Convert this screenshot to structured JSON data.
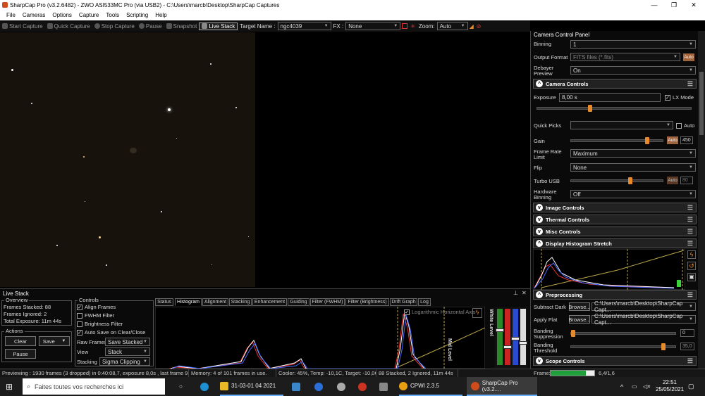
{
  "window": {
    "title": "SharpCap Pro (v3.2.6482) - ZWO ASI533MC Pro (via USB2) - C:\\Users\\marcb\\Desktop\\SharpCap Captures",
    "minimize_glyph": "—",
    "maximize_glyph": "❐",
    "close_glyph": "✕"
  },
  "menu": [
    "File",
    "Cameras",
    "Options",
    "Capture",
    "Tools",
    "Scripting",
    "Help"
  ],
  "toolbar": {
    "start_capture": "Start Capture",
    "quick_capture": "Quick Capture",
    "stop_capture": "Stop Capture",
    "pause": "Pause",
    "snapshot": "Snapshot",
    "live_stack": "Live Stack",
    "target_label": "Target Name :",
    "target_value": "ngc4039",
    "fx_label": "FX :",
    "fx_value": "None",
    "zoom_label": "Zoom:",
    "zoom_value": "Auto"
  },
  "camera_panel": {
    "title": "Camera Control Panel",
    "binning_label": "Binning",
    "binning_value": "1",
    "output_format_label": "Output Format",
    "output_format_value": "FITS files (*.fits)",
    "output_auto": "Auto",
    "debayer_label": "Debayer Preview",
    "debayer_value": "On",
    "sections": {
      "camera_controls": "Camera Controls",
      "image_controls": "Image Controls",
      "thermal_controls": "Thermal Controls",
      "misc_controls": "Misc Controls",
      "display_histogram": "Display Histogram Stretch",
      "preprocessing": "Preprocessing",
      "scope_controls": "Scope Controls"
    },
    "exposure_label": "Exposure",
    "exposure_value": "8,00 s",
    "lx_mode_label": "LX Mode",
    "quick_picks_label": "Quick Picks",
    "quick_picks_auto": "Auto",
    "gain_label": "Gain",
    "gain_auto": "Auto",
    "gain_value": "450",
    "gain_level": 0.85,
    "frame_rate_label": "Frame Rate Limit",
    "frame_rate_value": "Maximum",
    "flip_label": "Flip",
    "flip_value": "None",
    "turbo_label": "Turbo USB",
    "turbo_auto": "Auto",
    "turbo_value": "80",
    "turbo_level": 0.65,
    "hw_binning_label": "Hardware Binning",
    "hw_binning_value": "Off",
    "subtract_dark_label": "Subtract Dark",
    "subtract_dark_browse": "Browse...",
    "subtract_dark_path": "C:\\Users\\marcb\\Desktop\\SharpCap Capt...",
    "apply_flat_label": "Apply Flat",
    "apply_flat_browse": "Browse...",
    "apply_flat_path": "C:\\Users\\marcb\\Desktop\\SharpCap Capt...",
    "banding_suppression_label": "Banding Suppression",
    "banding_suppression_value": "0",
    "banding_threshold_label": "Banding Threshold",
    "banding_threshold_value": "35,0",
    "frame_label": "Frame:",
    "frame_value": "6,4/1,6",
    "frame_level": 0.8
  },
  "live_stack": {
    "title": "Live Stack",
    "pin_glyph": "⊥",
    "close_glyph": "✕",
    "overview_title": "Overview",
    "frames_stacked_label": "Frames Stacked:",
    "frames_stacked": "88",
    "frames_ignored_label": "Frames Ignored:",
    "frames_ignored": "2",
    "total_exposure_label": "Total Exposure:",
    "total_exposure": "11m 44s",
    "actions_title": "Actions",
    "clear": "Clear",
    "save": "Save",
    "pause": "Pause",
    "controls_title": "Controls",
    "align_frames": "Align Frames",
    "fwhm_filter": "FWHM Filter",
    "brightness_filter": "Brightness Filter",
    "auto_save": "Auto Save on Clear/Close",
    "raw_frames_label": "Raw Frames",
    "raw_frames_value": "Save Stacked",
    "view_label": "View",
    "view_value": "Stack",
    "stacking_label": "Stacking",
    "stacking_value": "Sigma Clipping",
    "tabs": [
      "Status",
      "Histogram",
      "Alignment",
      "Stacking",
      "Enhancement",
      "Guiding",
      "Filter (FWHM)",
      "Filter (Brightness)",
      "Drift Graph",
      "Log"
    ],
    "log_axis_label": "Logarithmic Horizontal Axis",
    "mid_level_label": "Mid Level",
    "white_level_label": "White Level"
  },
  "status_bar": {
    "preview": "Previewing : 1930 frames (3 dropped) in 0:40:08,7, exposure 8,0s , last frame 9,0s",
    "memory": "Memory: 4 of 101 frames in use.",
    "cooler": "Cooler: 45%, Temp: -10,1C, Target: -10,0C",
    "stack": "88 Stacked, 2 Ignored, 11m 44s"
  },
  "taskbar": {
    "search_placeholder": "Faites toutes vos recherches ici",
    "folder_label": "31-03-01 04 2021",
    "cpwi_label": "CPWI 2.3.5",
    "sharpcap_label": "SharpCap Pro (v3.2....",
    "time": "22:51",
    "date": "25/05/2021"
  }
}
